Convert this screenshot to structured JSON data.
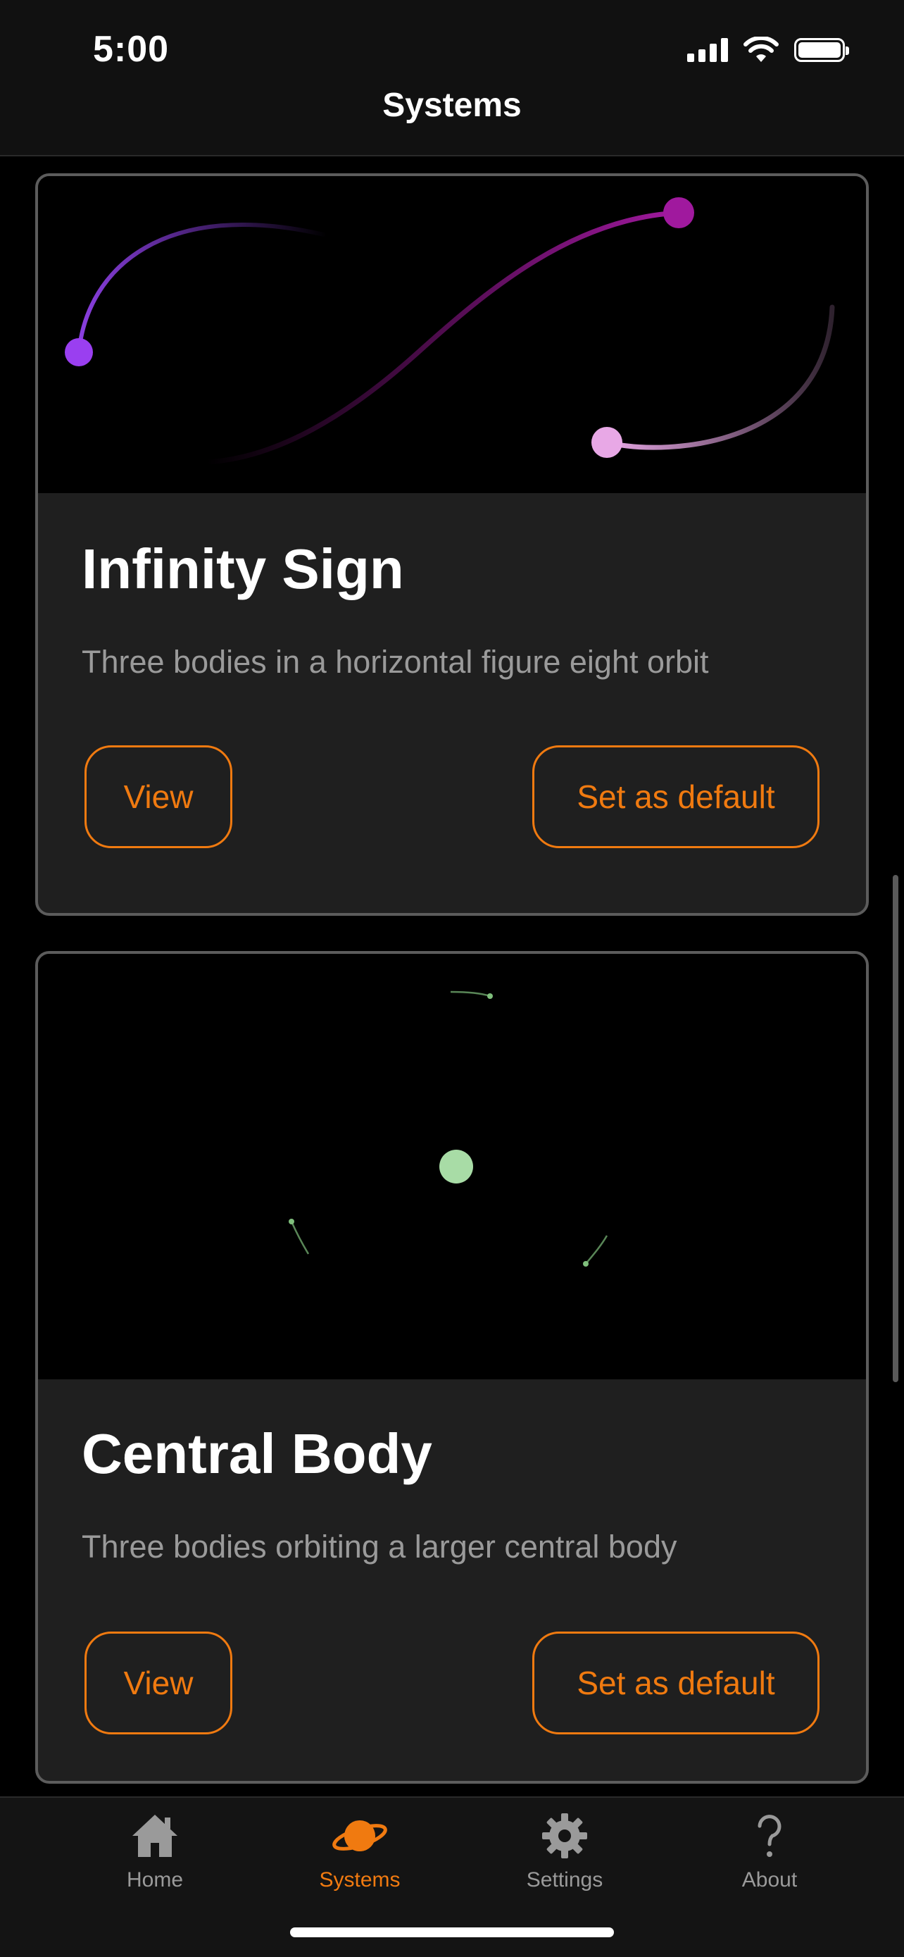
{
  "status_bar": {
    "time": "5:00"
  },
  "nav": {
    "title": "Systems"
  },
  "systems": [
    {
      "title": "Infinity Sign",
      "description": "Three bodies in a horizontal figure eight orbit",
      "view_label": "View",
      "default_label": "Set as default"
    },
    {
      "title": "Central Body",
      "description": "Three bodies orbiting a larger central body",
      "view_label": "View",
      "default_label": "Set as default"
    }
  ],
  "tabs": [
    {
      "label": "Home",
      "icon": "house-icon"
    },
    {
      "label": "Systems",
      "icon": "planet-icon",
      "active": true
    },
    {
      "label": "Settings",
      "icon": "gear-icon"
    },
    {
      "label": "About",
      "icon": "question-icon"
    }
  ],
  "colors": {
    "accent": "#f07a10",
    "card_bg": "#1f1f1f",
    "card_border": "#5c5c5c",
    "muted_text": "#9a9a9a"
  }
}
